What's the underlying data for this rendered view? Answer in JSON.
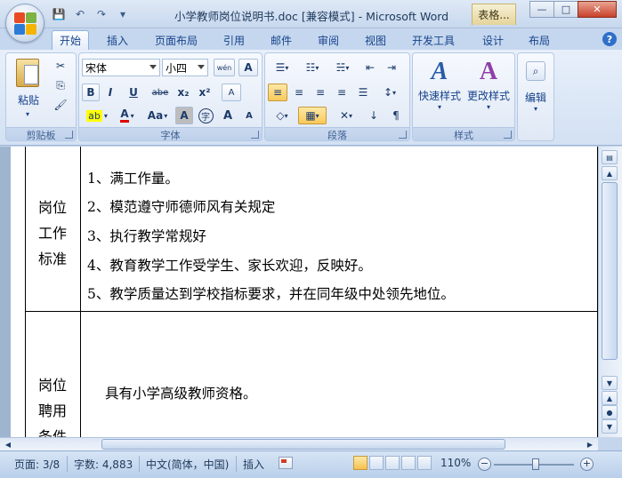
{
  "window": {
    "title": "小学教师岗位说明书.doc [兼容模式] - Microsoft Word",
    "context_tab": "表格...",
    "controls": {
      "minimize": "—",
      "maximize": "□",
      "close": "✕"
    }
  },
  "quick_access": {
    "save": "💾",
    "undo": "↶",
    "redo": "↷",
    "customize": "▾"
  },
  "ribbon_tabs": [
    {
      "label": "开始",
      "active": true
    },
    {
      "label": "插入"
    },
    {
      "label": "页面布局"
    },
    {
      "label": "引用"
    },
    {
      "label": "邮件"
    },
    {
      "label": "审阅"
    },
    {
      "label": "视图"
    },
    {
      "label": "开发工具"
    },
    {
      "label": "设计"
    },
    {
      "label": "布局"
    }
  ],
  "help": "?",
  "clipboard": {
    "group_label": "剪贴板",
    "paste_label": "粘贴",
    "cut": "✂",
    "copy": "⎘",
    "format_painter": "🖌"
  },
  "font": {
    "group_label": "字体",
    "font_name": "宋体",
    "font_size": "小四",
    "phonetic": "wén",
    "char_border": "A",
    "bold": "B",
    "italic": "I",
    "underline": "U",
    "strikethrough": "abe",
    "subscript": "x₂",
    "superscript": "x²",
    "clear_format": "A",
    "highlight": "ab",
    "font_color": "A",
    "change_case": "Aa",
    "char_shading": "A",
    "enclose": "字",
    "grow": "A",
    "shrink": "A"
  },
  "paragraph": {
    "group_label": "段落",
    "bullets": "☰",
    "numbering": "☷",
    "multilevel": "☵",
    "decrease_indent": "⇤",
    "increase_indent": "⇥",
    "align_left": "≡",
    "center": "≡",
    "align_right": "≡",
    "justify": "≡",
    "distributed": "☰",
    "line_spacing": "↕",
    "shading": "◇",
    "borders": "▦",
    "chinese_layout": "✕",
    "sort": "↓",
    "show_marks": "¶"
  },
  "styles": {
    "group_label": "样式",
    "quick_styles": "快速样式",
    "change_styles": "更改样式"
  },
  "editing": {
    "label": "编辑"
  },
  "document": {
    "standard_label": "岗位工作标准",
    "standard_lines": [
      "1、满工作量。",
      "2、模范遵守师德师风有关规定",
      "3、执行教学常规好",
      "4、教育教学工作受学生、家长欢迎，反映好。",
      "5、教学质量达到学校指标要求，并在同年级中处领先地位。"
    ],
    "hiring_label": "岗位聘用条件",
    "hiring_text": "具有小学高级教师资格。"
  },
  "status": {
    "page": "页面: 3/8",
    "words": "字数: 4,883",
    "language": "中文(简体，中国)",
    "mode": "插入",
    "zoom": "110%",
    "zoom_minus": "−",
    "zoom_plus": "+"
  },
  "colors": {
    "highlight": "#ffff00",
    "font_color": "#e00000",
    "accent": "#15428b"
  }
}
